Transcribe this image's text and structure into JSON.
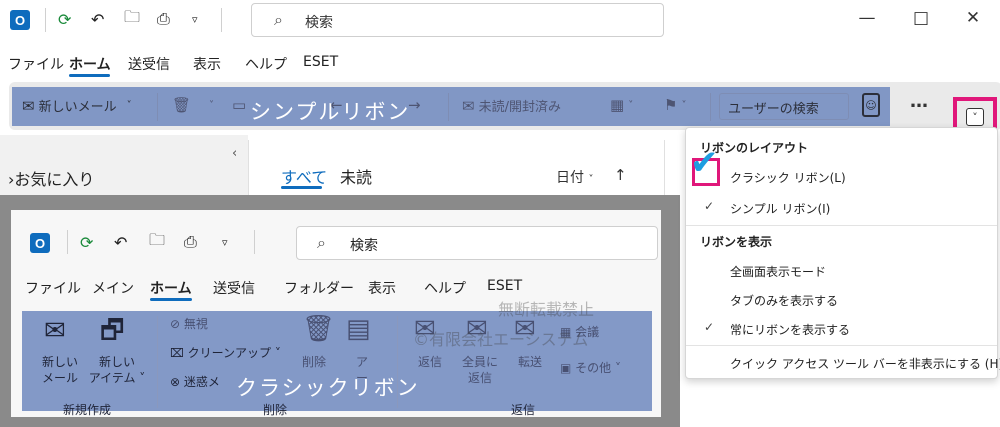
{
  "titlebar": {
    "app_logo": "O",
    "search_placeholder": "検索",
    "icons": [
      "outlook-logo-icon",
      "sync-icon",
      "undo-icon",
      "folder-icon",
      "print-icon",
      "dropdown-icon"
    ]
  },
  "window_controls": {
    "minimize": "—",
    "maximize": "□",
    "close": "✕"
  },
  "menu": [
    "ファイル",
    "ホーム",
    "送受信",
    "表示",
    "ヘルプ",
    "ESET"
  ],
  "simple_ribbon": {
    "new_mail": "新しいメール",
    "unread_read": "未読/開封済み",
    "user_search": "ユーザーの検索",
    "more": "…",
    "overlay_label": "シンプルリボン"
  },
  "mail_pane": {
    "favorites": "›お気に入り",
    "tab_all": "すべて",
    "tab_unread": "未読",
    "sort": "日付",
    "sort_arrow": "↑"
  },
  "classic": {
    "search_placeholder": "検索",
    "menu": [
      "ファイル",
      "メイン",
      "ホーム",
      "送受信",
      "フォルダー",
      "表示",
      "ヘルプ",
      "ESET"
    ],
    "buttons": {
      "new_mail": [
        "新しい",
        "メール"
      ],
      "new_item": [
        "新しい",
        "アイテム ˅"
      ],
      "ignore": "無視",
      "cleanup": "クリーンアップ ˅",
      "junk": "迷惑メ",
      "delete": "削除",
      "archive": [
        "ア",
        "ー"
      ],
      "reply": "返信",
      "reply_all": [
        "全員に",
        "返信"
      ],
      "forward": "転送",
      "meeting": "会議",
      "other": "その他 ˅"
    },
    "groups": [
      "新規作成",
      "削除",
      "返信"
    ],
    "overlay_label": "クラシックリボン",
    "watermark_line1": "無断転載禁止",
    "watermark_line2": "©有限会社エーシステム"
  },
  "ribbon_menu": {
    "layout_heading": "リボンのレイアウト",
    "classic_option": "クラシック リボン(L)",
    "simple_option": "シンプル リボン(I)",
    "display_heading": "リボンを表示",
    "fullscreen": "全画面表示モード",
    "tabs_only": "タブのみを表示する",
    "always_show": "常にリボンを表示する",
    "hide_qat": "クイック アクセス ツール バーを非表示にする (H)",
    "check": "✓",
    "big_check": "✔"
  },
  "colors": {
    "accent": "#0f6cbd",
    "highlight": "#e0177a",
    "overlay": "#6e88be"
  }
}
